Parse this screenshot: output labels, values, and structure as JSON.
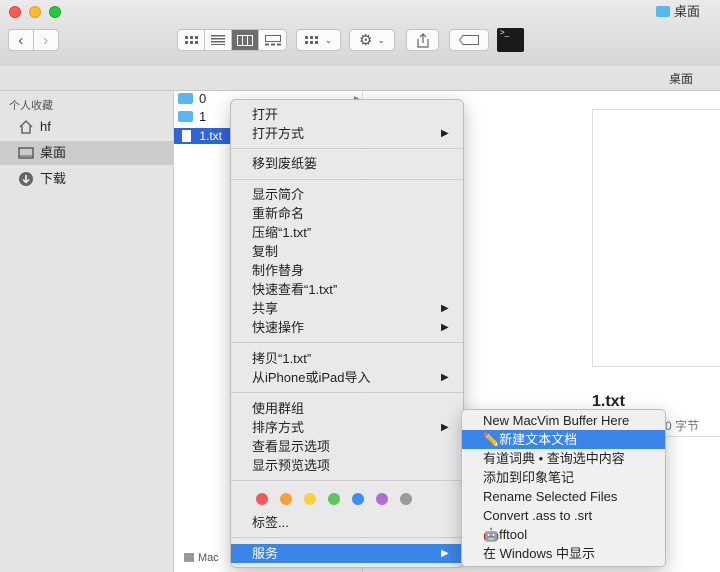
{
  "window": {
    "title": "桌面",
    "path_title": "桌面",
    "bottom_path": "Mac"
  },
  "sidebar": {
    "heading": "个人收藏",
    "items": [
      {
        "label": "hf",
        "icon": "home-icon"
      },
      {
        "label": "桌面",
        "icon": "desktop-icon"
      },
      {
        "label": "下载",
        "icon": "download-icon"
      }
    ]
  },
  "files": [
    {
      "name": "0",
      "type": "folder"
    },
    {
      "name": "1",
      "type": "folder"
    },
    {
      "name": "1.txt",
      "type": "file"
    }
  ],
  "preview": {
    "name": "1.txt",
    "size": "0 字节"
  },
  "context_menu": {
    "items": [
      {
        "label": "打开"
      },
      {
        "label": "打开方式"
      },
      {
        "label": "移到废纸篓"
      },
      {
        "label": "显示简介"
      },
      {
        "label": "重新命名"
      },
      {
        "label": "压缩“1.txt”"
      },
      {
        "label": "复制"
      },
      {
        "label": "制作替身"
      },
      {
        "label": "快速查看“1.txt”"
      },
      {
        "label": "共享"
      },
      {
        "label": "快速操作"
      },
      {
        "label": "拷贝“1.txt”"
      },
      {
        "label": "从iPhone或iPad导入"
      },
      {
        "label": "使用群组"
      },
      {
        "label": "排序方式"
      },
      {
        "label": "查看显示选项"
      },
      {
        "label": "显示预览选项"
      },
      {
        "label": "标签..."
      },
      {
        "label": "服务"
      }
    ],
    "tag_colors": [
      "#f05a5a",
      "#f7a03a",
      "#f7cf40",
      "#5dc65a",
      "#3f8ef5",
      "#b36bd6",
      "#9a9a9a"
    ]
  },
  "services_menu": {
    "items": [
      {
        "label": "New MacVim Buffer Here"
      },
      {
        "label": "✏️新建文本文档"
      },
      {
        "label": "有道词典 • 查询选中内容"
      },
      {
        "label": "添加到印象笔记"
      },
      {
        "label": "Rename Selected Files"
      },
      {
        "label": "Convert .ass to .srt"
      },
      {
        "label": "🤖fftool"
      },
      {
        "label": "在 Windows 中显示"
      }
    ]
  },
  "colors": {
    "highlight": "#3b85e9",
    "selection": "#2f66d6",
    "folder": "#5ab6ee"
  }
}
